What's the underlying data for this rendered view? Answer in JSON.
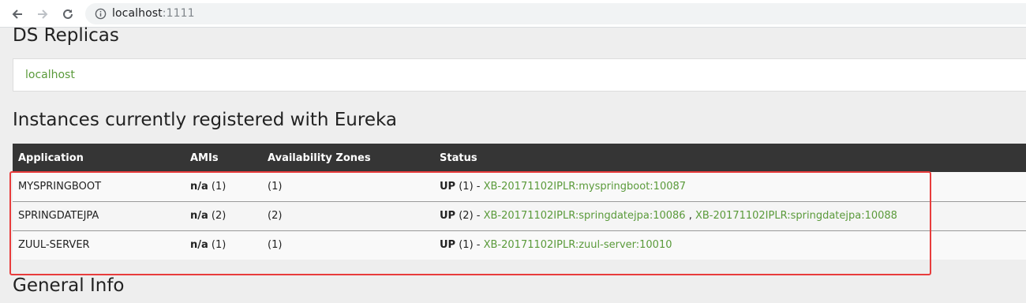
{
  "browser": {
    "url_host": "localhost",
    "url_port": ":1111"
  },
  "replicas": {
    "title": "DS Replicas",
    "link": "localhost"
  },
  "instances": {
    "title": "Instances currently registered with Eureka",
    "headers": [
      "Application",
      "AMIs",
      "Availability Zones",
      "Status"
    ],
    "rows": [
      {
        "app": "MYSPRINGBOOT",
        "ami_bold": "n/a",
        "ami_count": " (1)",
        "zones": "(1)",
        "status_bold": "UP",
        "status_count": " (1) - ",
        "link1": "XB-20171102IPLR:myspringboot:10087",
        "sep": "",
        "link2": ""
      },
      {
        "app": "SPRINGDATEJPA",
        "ami_bold": "n/a",
        "ami_count": " (2)",
        "zones": "(2)",
        "status_bold": "UP",
        "status_count": " (2) - ",
        "link1": "XB-20171102IPLR:springdatejpa:10086",
        "sep": " , ",
        "link2": "XB-20171102IPLR:springdatejpa:10088"
      },
      {
        "app": "ZUUL-SERVER",
        "ami_bold": "n/a",
        "ami_count": " (1)",
        "zones": "(1)",
        "status_bold": "UP",
        "status_count": " (1) - ",
        "link1": "XB-20171102IPLR:zuul-server:10010",
        "sep": "",
        "link2": ""
      }
    ]
  },
  "general": {
    "title": "General Info"
  },
  "colors": {
    "link": "#5a9a3a",
    "table_header": "#353535",
    "highlight_box": "#e83c3c"
  }
}
